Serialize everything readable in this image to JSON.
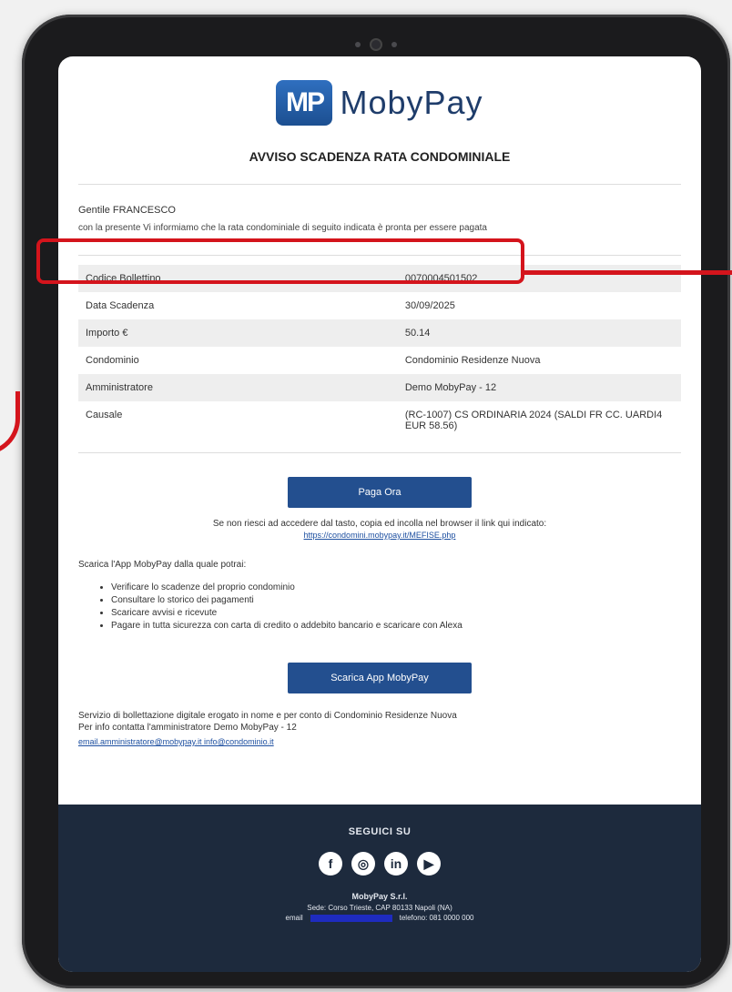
{
  "brand": {
    "logo_mark": "MP",
    "logo_text": "MobyPay"
  },
  "email": {
    "title": "AVVISO SCADENZA RATA CONDOMINIALE",
    "greeting": "Gentile FRANCESCO",
    "intro": "con la presente Vi informiamo che la rata condominiale di seguito indicata è pronta per essere pagata",
    "details": [
      {
        "label": "Codice Bollettino",
        "value": "0070004501502"
      },
      {
        "label": "Data Scadenza",
        "value": "30/09/2025"
      },
      {
        "label": "Importo €",
        "value": "50.14"
      },
      {
        "label": "Condominio",
        "value": "Condominio Residenze Nuova"
      },
      {
        "label": "Amministratore",
        "value": "Demo MobyPay - 12"
      },
      {
        "label": "Causale",
        "value": "(RC-1007) CS ORDINARIA 2024 (SALDI FR CC. UARDI4 EUR 58.56)"
      }
    ],
    "pay_button": "Paga Ora",
    "alt_text": "Se non riesci ad accedere dal tasto, copia ed incolla nel browser il link qui indicato:",
    "alt_link": "https://condomini.mobypay.it/MEFISE.php",
    "features_intro": "Scarica l'App MobyPay dalla quale potrai:",
    "features": [
      "Verificare lo scadenze del proprio condominio",
      "Consultare lo storico dei pagamenti",
      "Scaricare avvisi e ricevute",
      "Pagare in tutta sicurezza con carta di credito o addebito bancario e scaricare con Alexa"
    ],
    "app_button": "Scarica App MobyPay",
    "footer_note_1": "Servizio di bollettazione digitale erogato in nome e per conto di Condominio Residenze Nuova",
    "footer_note_2": "Per info contatta l'amministratore Demo MobyPay - 12",
    "footer_links": "email.amministratore@mobypay.it  info@condominio.it"
  },
  "footer": {
    "follow_label": "SEGUICI SU",
    "socials": [
      "facebook-icon",
      "instagram-icon",
      "linkedin-icon",
      "youtube-icon"
    ],
    "company": "MobyPay S.r.l.",
    "company_line": "Sede: Corso Trieste, CAP 80133 Napoli (NA)",
    "email_label": "email",
    "phone": "telefono: 081 0000 000"
  },
  "colors": {
    "brand_blue": "#234f8f",
    "footer_bg": "#1d2a3d",
    "highlight_red": "#d4141c"
  }
}
